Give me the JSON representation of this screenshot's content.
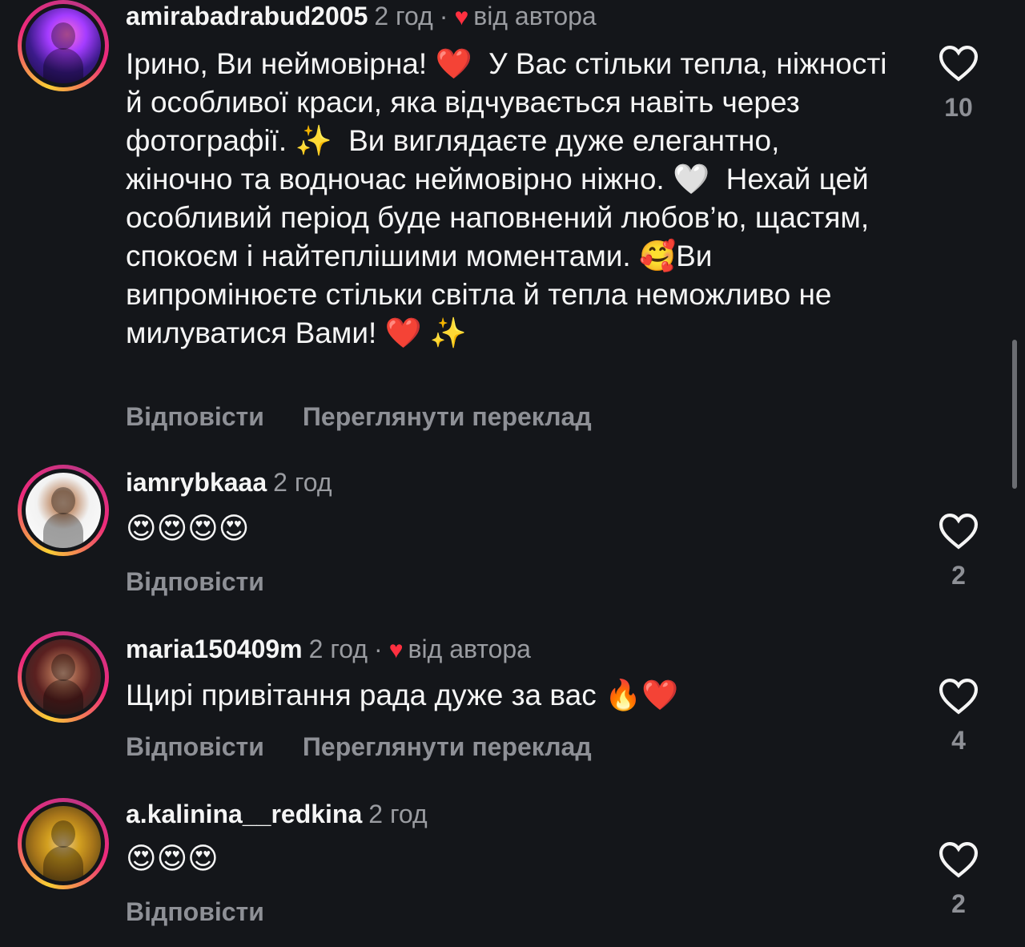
{
  "comments": [
    {
      "username": "amirabadrabud2005",
      "time": "2 год",
      "liked_by_author": true,
      "by_author_label": "від автора",
      "text": "Ірино, Ви неймовірна! ❤️  У Вас стільки тепла, ніжності й особливої краси, яка відчувається навіть через фотографії. ✨  Ви виглядаєте дуже елегантно, жіночно та водночас неймовірно ніжно. 🤍  Нехай цей особливий період буде наповнений любов’ю, щастям, спокоєм і найтеплішими моментами. 🥰Ви випромінюєте стільки світла й тепла неможливо не милуватися Вами! ❤️ ✨",
      "reply_label": "Відповісти",
      "translate_label": "Переглянути переклад",
      "likes": "10"
    },
    {
      "username": "iamrybkaaa",
      "time": "2 год",
      "liked_by_author": false,
      "text": "😍😍😍😍",
      "reply_label": "Відповісти",
      "likes": "2"
    },
    {
      "username": "maria150409m",
      "time": "2 год",
      "liked_by_author": true,
      "by_author_label": "від автора",
      "text": "Щирі привітання рада дуже за вас 🔥❤️",
      "reply_label": "Відповісти",
      "translate_label": "Переглянути переклад",
      "likes": "4"
    },
    {
      "username": "a.kalinina__redkina",
      "time": "2 год",
      "liked_by_author": false,
      "text": "😍😍😍",
      "reply_label": "Відповісти",
      "likes": "2"
    }
  ],
  "colors": {
    "background": "#14161a",
    "text": "#f5f5f5",
    "muted": "#9a9ca1",
    "heart": "#ff3040"
  },
  "icons": {
    "like": "heart-outline-icon",
    "author_like": "heart-filled-icon"
  }
}
